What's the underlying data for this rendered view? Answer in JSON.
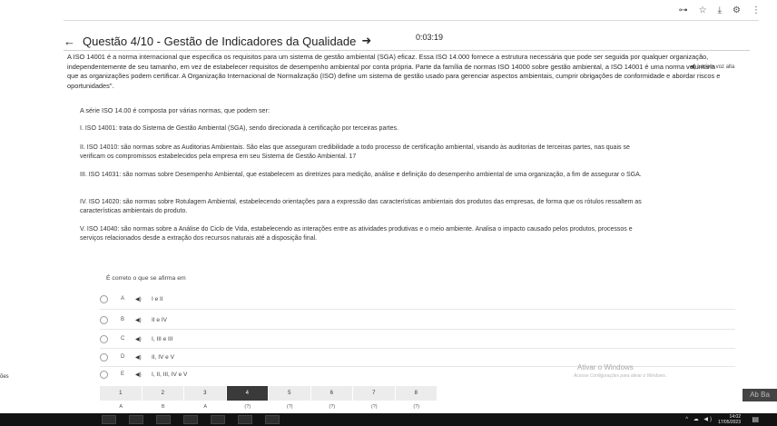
{
  "chrome": {
    "icons": [
      "key-icon",
      "star-icon",
      "download-icon",
      "gear-icon",
      "more-icon"
    ],
    "glyphs": {
      "key": "⊶",
      "star": "☆",
      "download": "⤓",
      "gear": "⚙",
      "more": "⋮"
    }
  },
  "header": {
    "back_glyph": "←",
    "title": "Questão 4/10 - Gestão de Indicadores da Qualidade",
    "title_arrow": "➜",
    "timer": "0:03:19"
  },
  "read_aloud": "◀) Ler em voz alta",
  "statement": "A ISO 14001 é a norma internacional que especifica os requisitos para um sistema de gestão ambiental (SGA) eficaz. Essa ISO 14.000 fornece a estrutura necessária que pode ser seguida por qualquer organização, independentemente de seu tamanho, em vez de estabelecer requisitos de desempenho ambiental por conta própria. Parte da família de normas ISO 14000 sobre gestão ambiental, a ISO 14001 é uma norma voluntária que as organizações podem certificar. A Organização Internacional de Normalização (ISO) define um sistema de gestão usado para gerenciar aspectos ambientais, cumprir obrigações de conformidade e abordar riscos e oportunidades\".",
  "prompt": "A série ISO 14.00 é composta por várias normas, que podem ser:",
  "items": [
    "I. ISO 14001: trata do Sistema de Gestão Ambiental (SGA), sendo direcionada à certificação por terceiras partes.",
    "II. ISO 14010: são normas sobre as Auditorias Ambientais. São elas que asseguram credibilidade a todo processo de certificação ambiental, visando às auditorias de terceiras partes, nas quais se verificam os compromissos estabelecidos pela empresa em seu Sistema de Gestão Ambiental. 17",
    "III. ISO 14031: são normas sobre Desempenho Ambiental, que estabelecem as diretrizes para medição, análise e definição do desempenho ambiental de uma organização, a fim de assegurar o SGA.",
    "IV. ISO 14020: são normas sobre Rotulagem Ambiental, estabelecendo orientações para a expressão das características ambientais dos produtos das empresas, de forma que os rótulos ressaltem as características ambientais do produto.",
    "V. ISO 14040: são normas sobre a Análise do Ciclo de Vida, estabelecendo as interações entre as atividades produtivas e o meio ambiente. Analisa o impacto causado pelos produtos, processos e serviços relacionados desde a extração dos recursos naturais até a disposição final."
  ],
  "question": "É correto o que se afirma em",
  "speaker_glyph": "◀)",
  "options": [
    {
      "letter": "A",
      "text": "I e II"
    },
    {
      "letter": "B",
      "text": "II e IV"
    },
    {
      "letter": "C",
      "text": "I, III e III"
    },
    {
      "letter": "D",
      "text": "II, IV e V"
    },
    {
      "letter": "E",
      "text": "I, II, III, IV e V"
    }
  ],
  "watermark": {
    "title": "Ativar o Windows",
    "subtitle": "Acesse Configurações para ativar o Windows."
  },
  "pager": {
    "pages": [
      "1",
      "2",
      "3",
      "4",
      "5",
      "6",
      "7",
      "8"
    ],
    "active_index": 3,
    "answers": [
      "A",
      "B",
      "A",
      "(?)",
      "(?)",
      "(?)",
      "(?)",
      "(?)"
    ]
  },
  "taskbar": {
    "tray": "^ ☁ ◀) ",
    "time": "14:02",
    "date": "17/05/2023",
    "notify": "▤"
  },
  "fragments": {
    "left": "ões",
    "right": "Ab Ba"
  }
}
